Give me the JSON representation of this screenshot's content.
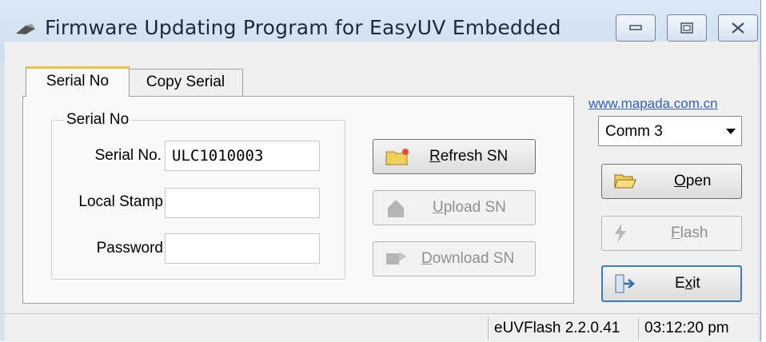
{
  "window": {
    "title": "Firmware Updating Program for EasyUV Embedded",
    "controls": {
      "minimize": "minimize-icon",
      "maximize": "maximize-icon",
      "close": "close-icon"
    }
  },
  "tabs": [
    {
      "label": "Serial No",
      "active": true
    },
    {
      "label": "Copy Serial",
      "active": false
    }
  ],
  "link": "www.mapada.com.cn",
  "group": {
    "title": "Serial No",
    "fields": {
      "serial": {
        "label": "Serial No.",
        "value": "ULC1010003"
      },
      "stamp": {
        "label": "Local Stamp",
        "value": ""
      },
      "password": {
        "label": "Password",
        "value": ""
      }
    }
  },
  "buttons": {
    "refresh": {
      "accel": "R",
      "rest": "efresh SN",
      "enabled": true
    },
    "upload": {
      "accel": "U",
      "rest": "pload SN",
      "enabled": false
    },
    "download": {
      "accel": "D",
      "rest": "ownload SN",
      "enabled": false
    },
    "open": {
      "accel": "O",
      "rest": "pen",
      "enabled": true
    },
    "flash": {
      "accel": "F",
      "rest": "lash",
      "enabled": false
    },
    "exit_pre": "E",
    "exit_accel": "x",
    "exit_rest": "it"
  },
  "port": {
    "selected": "Comm 3"
  },
  "status": {
    "version": "eUVFlash 2.2.0.41",
    "time": "03:12:20 pm"
  },
  "colors": {
    "title_bg": "#d7e3ef",
    "link": "#3060c0",
    "tab_highlight": "#f0c040"
  }
}
